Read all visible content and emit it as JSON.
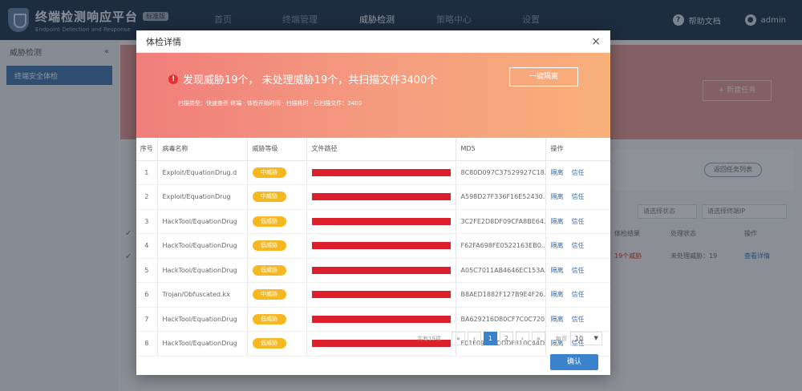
{
  "app": {
    "title": "终端检测响应平台",
    "badge": "标准版",
    "subtitle": "Endpoint Detection and Response"
  },
  "nav": [
    "首页",
    "终端管理",
    "威胁检测",
    "策略中心",
    "设置"
  ],
  "nav_active_index": 2,
  "topbar": {
    "help_label": "帮助文档",
    "user_label": "admin"
  },
  "sidebar": {
    "title": "威胁检测",
    "items": [
      {
        "label": "终端安全体检"
      }
    ]
  },
  "background": {
    "banner_button": "+ 新建任务",
    "pill_button": "返回任务列表",
    "select_1": "请选择状态",
    "select_2": "请选择终端IP",
    "col_result": "体检结果",
    "col_status": "处理状态",
    "col_op": "操作",
    "row_result": "19个威胁",
    "row_status": "未处理威胁：19",
    "row_op": "查看详情"
  },
  "modal": {
    "title": "体检详情",
    "summary_text": "发现威胁19个， 未处理威胁19个，共扫描文件3400个",
    "summary_sub": "扫描类型：快速查杀 终端 · 体检开始时间 · 扫描耗时 · 已扫描文件：3400",
    "summary_button": "一键隔离",
    "columns": [
      "序号",
      "病毒名称",
      "威胁等级",
      "文件路径",
      "MD5",
      "操作"
    ],
    "rows": [
      {
        "idx": "1",
        "name": "Exploit/EquationDrug.d",
        "level": "中威胁",
        "md5": "8C80D097C37529927C18..."
      },
      {
        "idx": "2",
        "name": "Exploit/EquationDrug",
        "level": "中威胁",
        "md5": "A598D27F336F16E52430..."
      },
      {
        "idx": "3",
        "name": "HackTool/EquationDrug",
        "level": "低威胁",
        "md5": "3C2FE2D8DF09CFA8BE64..."
      },
      {
        "idx": "4",
        "name": "HackTool/EquationDrug",
        "level": "低威胁",
        "md5": "F62FA698FE0522163EB0..."
      },
      {
        "idx": "5",
        "name": "HackTool/EquationDrug",
        "level": "低威胁",
        "md5": "A05C7011AB4646EC153A..."
      },
      {
        "idx": "6",
        "name": "Trojan/Obfuscated.kx",
        "level": "中威胁",
        "md5": "B8AED1882F127B9E4F26..."
      },
      {
        "idx": "7",
        "name": "HackTool/EquationDrug",
        "level": "低威胁",
        "md5": "BA629216D80CF7C0C720..."
      },
      {
        "idx": "8",
        "name": "HackTool/EquationDrug",
        "level": "低威胁",
        "md5": "F01F09F09DDDF810C44D..."
      }
    ],
    "row_actions": {
      "isolate": "隔离",
      "trust": "信任"
    },
    "pagination": {
      "total": "共有19项",
      "prev_first": "«",
      "prev": "‹",
      "pages": [
        "1",
        "2"
      ],
      "next": "›",
      "next_last": "»",
      "per_page_label": "每页",
      "per_page_value": "10"
    },
    "ok_button": "确认",
    "close_glyph": "×"
  },
  "colors": {
    "topbar": "#1e3350",
    "accent": "#3a82cc",
    "path_bar": "#dc1f2a",
    "level_badge": "#f6b821",
    "summary_gradient_start": "#f07e7b",
    "summary_gradient_end": "#f8b079"
  },
  "icons": [
    "shield-logo-icon",
    "help-icon",
    "user-icon",
    "close-icon",
    "alert-icon",
    "caret-down-icon"
  ]
}
